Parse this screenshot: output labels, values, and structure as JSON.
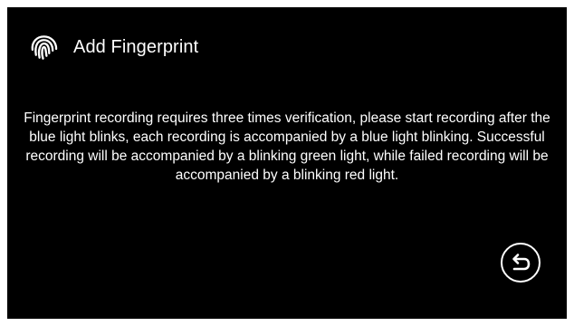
{
  "header": {
    "icon": "fingerprint-icon",
    "title": "Add Fingerprint"
  },
  "main": {
    "message": "Fingerprint recording requires three times verification, please start recording after the blue light blinks, each recording is accompanied by a blue light blinking. Successful recording will be accompanied by a blinking green light, while failed recording will be accompanied by a blinking red light."
  },
  "footer": {
    "back_icon": "back-arrow-icon"
  },
  "colors": {
    "background": "#000000",
    "text": "#ffffff"
  }
}
